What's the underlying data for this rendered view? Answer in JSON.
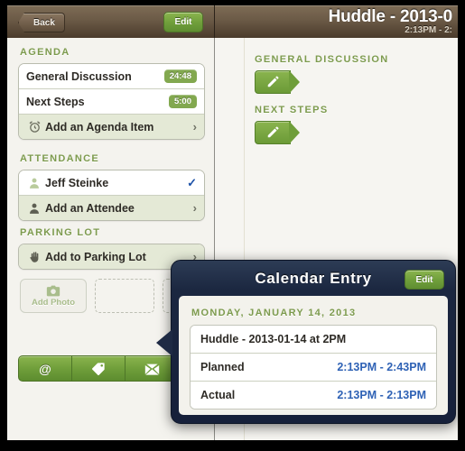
{
  "navbar": {
    "back_label": "Back",
    "edit_label": "Edit",
    "title": "Huddle - 2013-0",
    "subtitle": "2:13PM - 2:"
  },
  "left_pane": {
    "sections": [
      {
        "header": "Agenda",
        "rows": [
          {
            "label": "General Discussion",
            "badge": "24:48",
            "icon": "",
            "style": "white"
          },
          {
            "label": "Next Steps",
            "badge": "5:00",
            "icon": "",
            "style": "white"
          },
          {
            "label": "Add an Agenda Item",
            "badge": "",
            "icon": "alarm-clock-icon",
            "style": "shade",
            "chevron": "›"
          }
        ]
      },
      {
        "header": "Attendance",
        "rows": [
          {
            "label": "Jeff Steinke",
            "icon": "person-icon",
            "style": "white",
            "check": "✓"
          },
          {
            "label": "Add an Attendee",
            "icon": "person-icon",
            "style": "shade",
            "chevron": "›"
          }
        ]
      },
      {
        "header": "Parking Lot",
        "rows": [
          {
            "label": "Add to Parking Lot",
            "icon": "hand-icon",
            "style": "shade",
            "chevron": "›"
          }
        ]
      }
    ],
    "add_photo_label": "Add Photo",
    "toolbar": [
      {
        "icon": "at-sign-icon",
        "glyph": "@"
      },
      {
        "icon": "tag-icon",
        "glyph": ""
      },
      {
        "icon": "mail-icon",
        "glyph": ""
      }
    ]
  },
  "right_pane": {
    "notes": [
      {
        "header": "General Discussion",
        "edit_icon": "pencil-icon"
      },
      {
        "header": "Next Steps",
        "edit_icon": "pencil-icon"
      }
    ]
  },
  "popover": {
    "title": "Calendar Entry",
    "edit_label": "Edit",
    "date": "Monday, January 14, 2013",
    "rows": [
      {
        "label": "Huddle - 2013-01-14 at 2PM",
        "value": ""
      },
      {
        "label": "Planned",
        "value": "2:13PM - 2:43PM"
      },
      {
        "label": "Actual",
        "value": "2:13PM - 2:13PM"
      }
    ]
  },
  "colors": {
    "green": "#7aa845",
    "brown": "#6b5a46",
    "navy": "#1b2740",
    "blue_value": "#2f62b5"
  }
}
